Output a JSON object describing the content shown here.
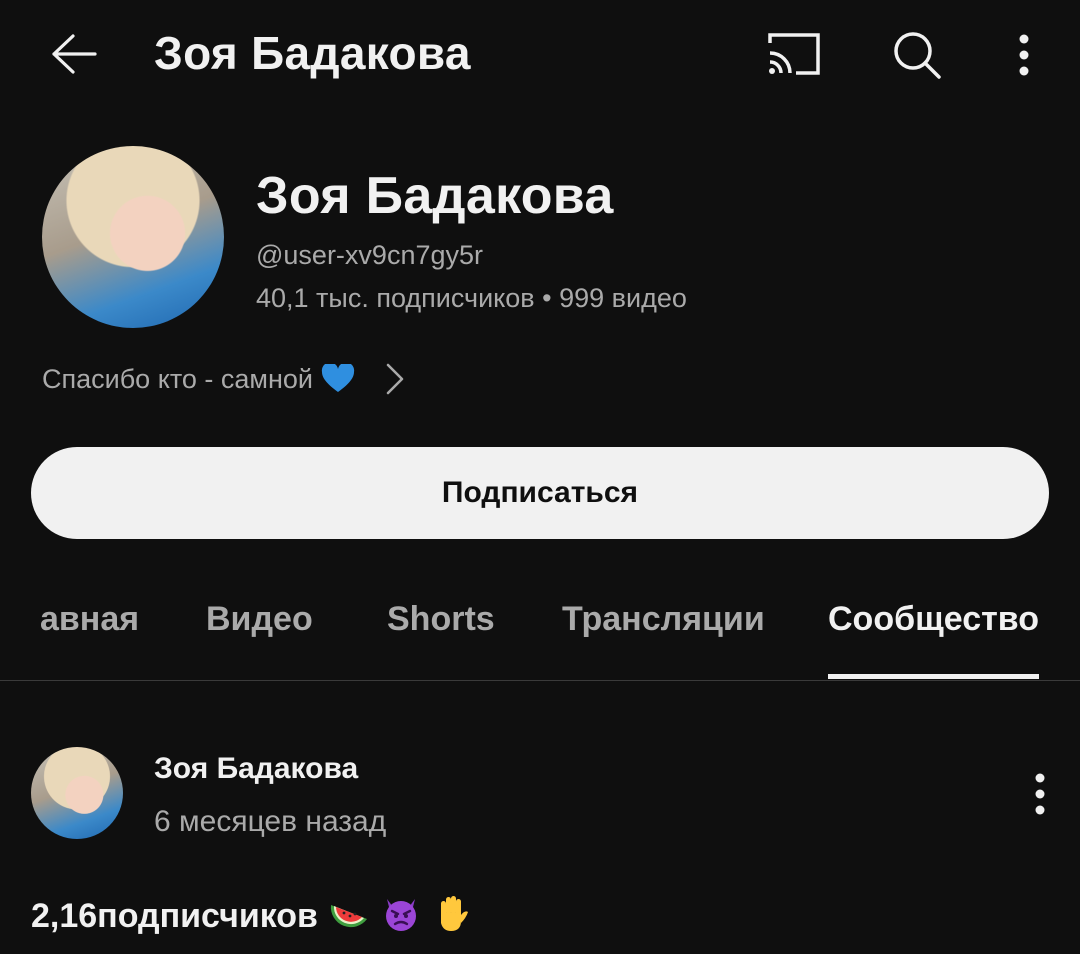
{
  "header": {
    "title": "Зоя Бадакова",
    "icons": [
      "arrow-back-icon",
      "cast-icon",
      "search-icon",
      "more-vert-icon"
    ]
  },
  "channel": {
    "name": "Зоя Бадакова",
    "handle": "@user-xv9cn7gy5r",
    "stats": "40,1 тыс. подписчиков • 999 видео",
    "description": "Спасибо кто - самной",
    "description_emoji": "blue-heart-icon"
  },
  "subscribe_button": {
    "label": "Подписаться"
  },
  "tabs": [
    {
      "label": "авная",
      "active": false
    },
    {
      "label": "Видео",
      "active": false
    },
    {
      "label": "Shorts",
      "active": false
    },
    {
      "label": "Трансляции",
      "active": false
    },
    {
      "label": "Сообщество",
      "active": true
    }
  ],
  "post": {
    "author": "Зоя Бадакова",
    "time": "6 месяцев назад",
    "text": "2,16подписчиков",
    "emoji": [
      "watermelon-icon",
      "angry-devil-icon",
      "raised-hand-icon"
    ]
  },
  "colors": {
    "background": "#0f0f0f",
    "text_primary": "#f1f1f1",
    "text_secondary": "#aaaaaa",
    "button_bg": "#f1f1f1"
  }
}
